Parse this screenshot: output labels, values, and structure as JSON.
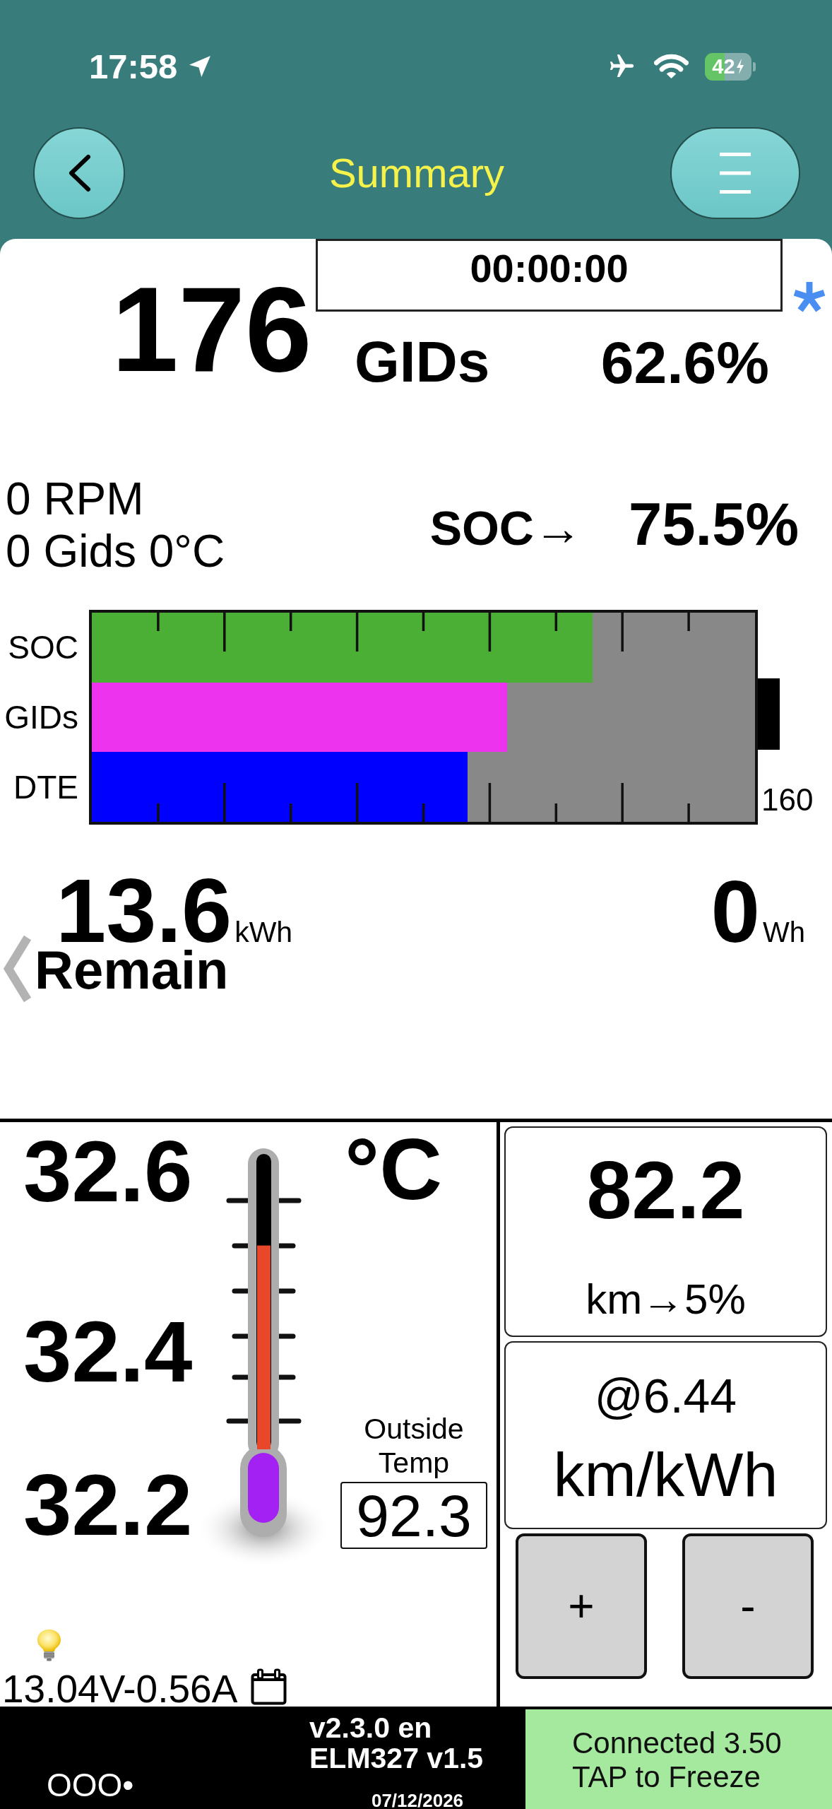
{
  "status_bar": {
    "time": "17:58",
    "battery": "42"
  },
  "nav": {
    "title": "Summary"
  },
  "timer": "00:00:00",
  "gids": {
    "count": "176",
    "unit": "GIDs",
    "percent": "62.6%"
  },
  "readouts": [
    "0 RPM",
    "0 Gids 0°C"
  ],
  "soc": {
    "label": "SOC→",
    "value": "75.5%"
  },
  "gauge": {
    "bars": [
      {
        "label": "SOC",
        "level": 0.755,
        "color": "#4caf35"
      },
      {
        "label": "GIDs",
        "level": 0.626,
        "color": "#ee33ee"
      },
      {
        "label": "DTE",
        "level": 0.567,
        "color": "#0000ff"
      }
    ],
    "end_label": "160"
  },
  "energy": {
    "remaining": {
      "value": "13.6",
      "unit": "kWh",
      "label": "Remain"
    },
    "used": {
      "value": "0",
      "unit": "Wh"
    }
  },
  "temperature": {
    "readings": [
      "32.6",
      "32.4",
      "32.2"
    ],
    "unit": "°C",
    "level": 0.69,
    "outside_label": "Outside Temp",
    "outside_value": "92.3"
  },
  "electrical": "13.04V-0.56A",
  "range": {
    "value": "82.2",
    "label": "km→5%"
  },
  "efficiency": {
    "value": "@6.44",
    "unit": "km/kWh"
  },
  "buttons": [
    "+",
    "-"
  ],
  "footer": {
    "indicator": "OOO•",
    "version": [
      "v2.3.0 en",
      "ELM327 v1.5"
    ],
    "date": "07/12/2026",
    "connection": [
      "Connected 3.50",
      "TAP to Freeze"
    ]
  }
}
